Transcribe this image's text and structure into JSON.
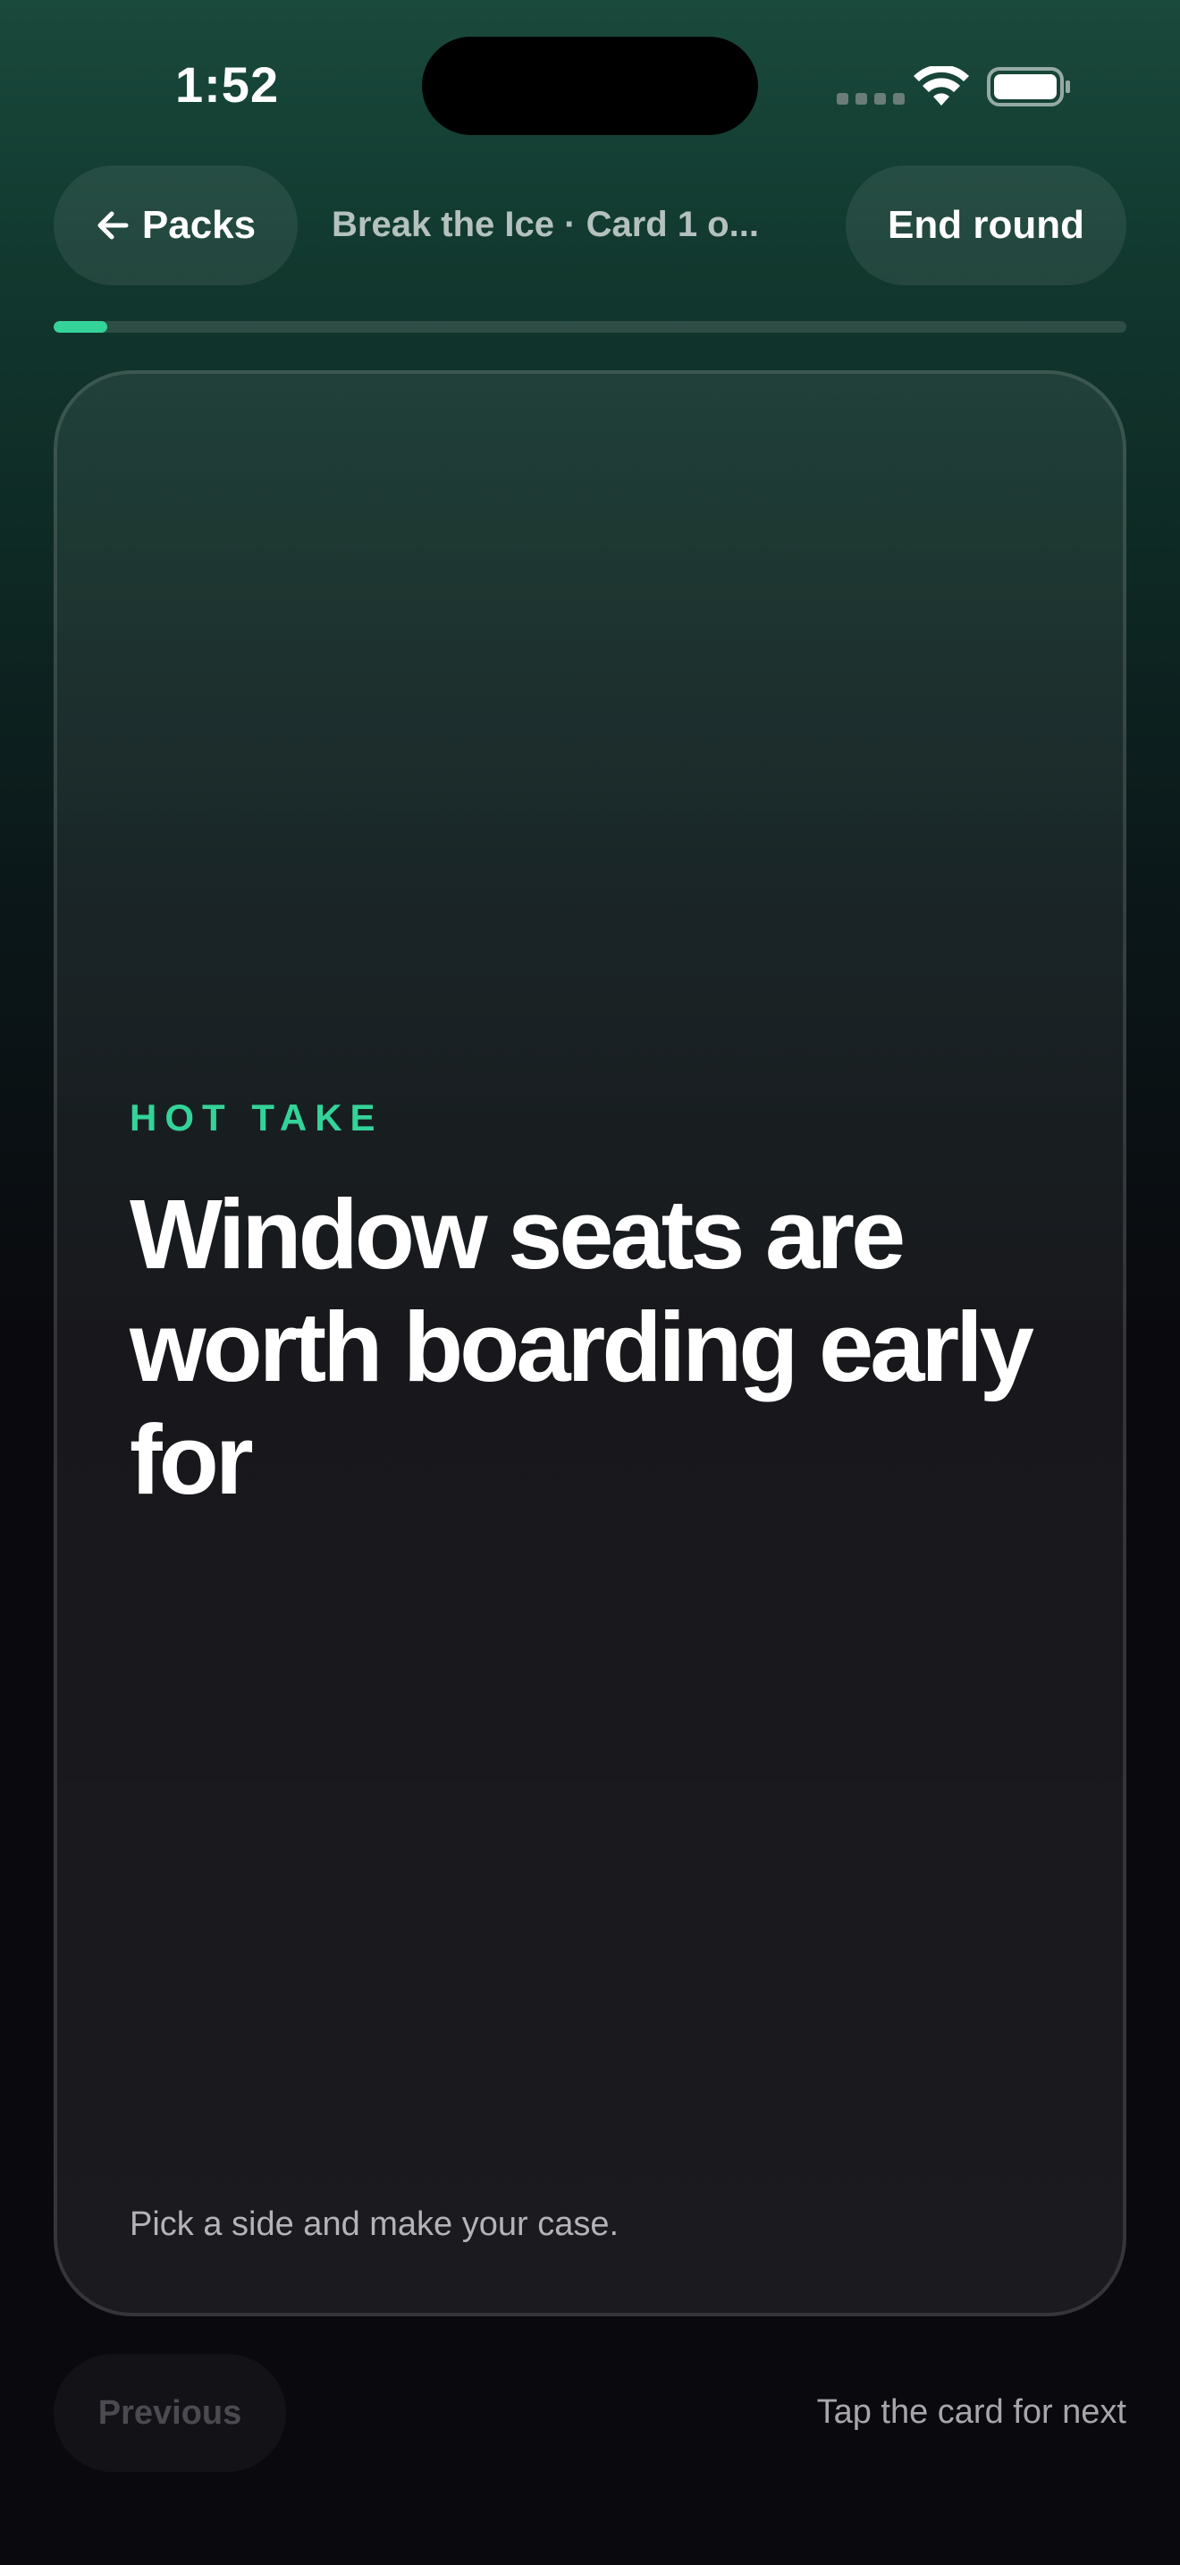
{
  "status_bar": {
    "time": "1:52"
  },
  "header": {
    "back_label": "Packs",
    "title": "Break the Ice · Card 1 o...",
    "end_label": "End round"
  },
  "progress": {
    "fraction": 0.05,
    "accent_color": "#34d399"
  },
  "card": {
    "category": "HOT TAKE",
    "prompt": "Window seats are worth boarding early for",
    "hint": "Pick a side and make your case."
  },
  "footer": {
    "previous_label": "Previous",
    "next_hint": "Tap the card for next"
  },
  "icons": {
    "back": "arrow-left-icon",
    "wifi": "wifi-icon",
    "battery": "battery-icon",
    "signal": "cellular-signal-icon"
  }
}
